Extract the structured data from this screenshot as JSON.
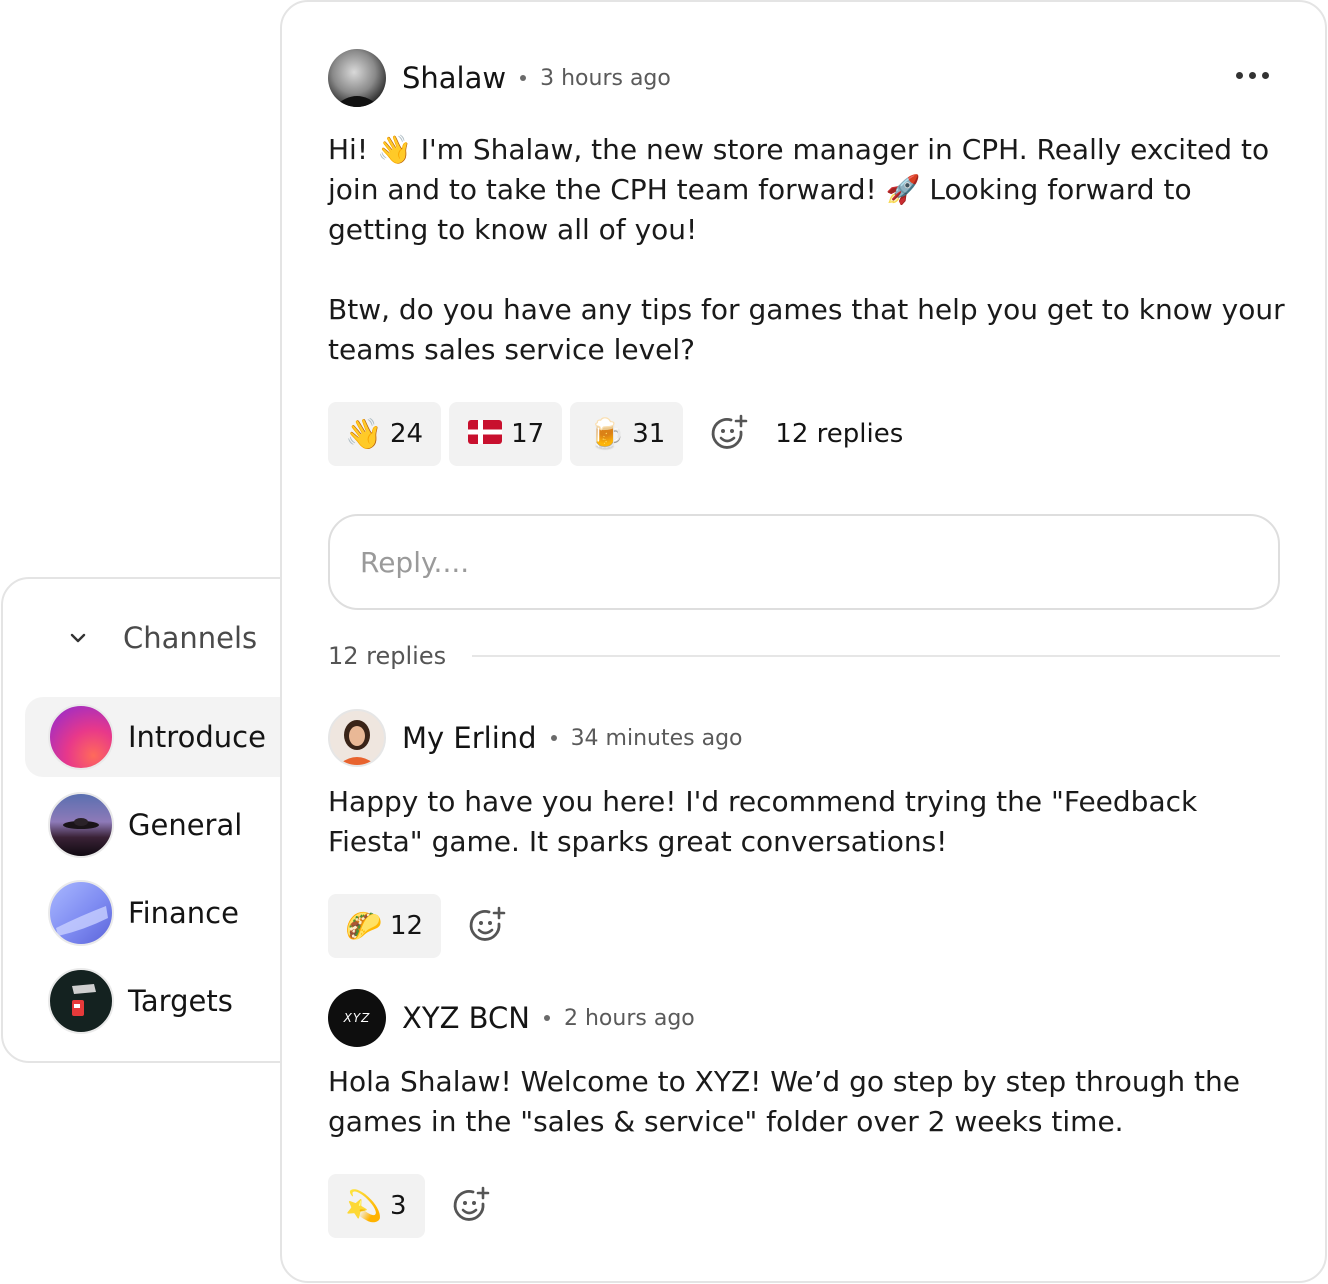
{
  "sidebar": {
    "title": "Channels",
    "items": [
      {
        "label": "Introduce",
        "active": true
      },
      {
        "label": "General",
        "active": false
      },
      {
        "label": "Finance",
        "active": false
      },
      {
        "label": "Targets",
        "active": false
      }
    ]
  },
  "post": {
    "author": "Shalaw",
    "time": "3 hours ago",
    "body": "Hi! 👋 I'm Shalaw, the new store manager in CPH. Really excited to join and to take the CPH team forward! 🚀 Looking forward to getting to know all of you!\n\nBtw, do you have any tips for games that help you get to know your teams sales service level?",
    "reactions": [
      {
        "emoji": "👋",
        "count": "24"
      },
      {
        "emoji": "🇩🇰",
        "count": "17"
      },
      {
        "emoji": "🍺",
        "count": "31"
      }
    ],
    "replies_link": "12 replies"
  },
  "reply_input": {
    "placeholder": "Reply...."
  },
  "replies_divider": "12 replies",
  "replies": [
    {
      "author": "My Erlind",
      "time": "34 minutes ago",
      "body": "Happy to have you here! I'd recommend trying the \"Feedback Fiesta\" game. It sparks great conversations!",
      "reactions": [
        {
          "emoji": "🌮",
          "count": "12"
        }
      ]
    },
    {
      "author": "XYZ BCN",
      "avatar_text": "XYZ",
      "time": "2 hours ago",
      "body": "Hola Shalaw! Welcome to XYZ! We’d go step by step through the games in the \"sales & service\" folder over 2 weeks time.",
      "reactions": [
        {
          "emoji": "💫",
          "count": "3"
        }
      ]
    }
  ],
  "colors": {
    "border": "#e4e4e4",
    "pill_bg": "#f2f2f2",
    "active_bg": "#f3f3f3"
  }
}
